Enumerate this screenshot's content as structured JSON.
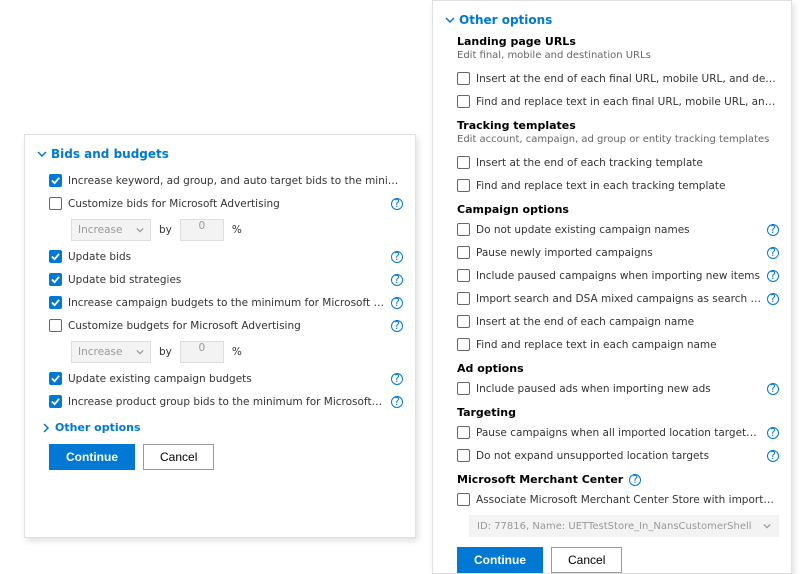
{
  "left": {
    "section_title": "Bids and budgets",
    "items": [
      {
        "checked": true,
        "label": "Increase keyword, ad group, and auto target bids to the minimum for Microsoft Adve",
        "help": false
      },
      {
        "checked": false,
        "label": "Customize bids for Microsoft Advertising",
        "help": true
      }
    ],
    "customize1": {
      "select": "Increase",
      "by_label": "by",
      "value": "0",
      "unit": "%"
    },
    "items2": [
      {
        "checked": true,
        "label": "Update bids",
        "help": true
      },
      {
        "checked": true,
        "label": "Update bid strategies",
        "help": true
      },
      {
        "checked": true,
        "label": "Increase campaign budgets to the minimum for Microsoft Advertising",
        "help": true
      },
      {
        "checked": false,
        "label": "Customize budgets for Microsoft Advertising",
        "help": true
      }
    ],
    "customize2": {
      "select": "Increase",
      "by_label": "by",
      "value": "0",
      "unit": "%"
    },
    "items3": [
      {
        "checked": true,
        "label": "Update existing campaign budgets",
        "help": true
      },
      {
        "checked": true,
        "label": "Increase product group bids to the minimum for Microsoft Advertising",
        "help": true
      }
    ],
    "other_options": "Other options",
    "continue": "Continue",
    "cancel": "Cancel"
  },
  "right": {
    "section_title": "Other options",
    "landing_header": "Landing page URLs",
    "landing_caption": "Edit final, mobile and destination URLs",
    "landing_items": [
      "Insert at the end of each final URL, mobile URL, and destination URL",
      "Find and replace text in each final URL, mobile URL, and destination URL"
    ],
    "tracking_header": "Tracking templates",
    "tracking_caption": "Edit account, campaign, ad group or entity tracking templates",
    "tracking_items": [
      "Insert at the end of each tracking template",
      "Find and replace text in each tracking template"
    ],
    "campaign_header": "Campaign options",
    "campaign_items": [
      {
        "label": "Do not update existing campaign names",
        "help": true
      },
      {
        "label": "Pause newly imported campaigns",
        "help": true
      },
      {
        "label": "Include paused campaigns when importing new items",
        "help": true
      },
      {
        "label": "Import search and DSA mixed campaigns as search campaigns",
        "help": true
      },
      {
        "label": "Insert at the end of each campaign name",
        "help": false
      },
      {
        "label": "Find and replace text in each campaign name",
        "help": false
      }
    ],
    "ad_header": "Ad options",
    "ad_items": [
      {
        "label": "Include paused ads when importing new ads",
        "help": true
      }
    ],
    "targeting_header": "Targeting",
    "targeting_items": [
      {
        "label": "Pause campaigns when all imported location targets are unsupported",
        "help": true
      },
      {
        "label": "Do not expand unsupported location targets",
        "help": true
      }
    ],
    "mmc_header": "Microsoft Merchant Center",
    "mmc_items": [
      {
        "label": "Associate Microsoft Merchant Center Store with imported shopping campaigns and ad e",
        "help": false
      }
    ],
    "store_row": "ID: 77816, Name: UETTestStore_In_NansCustomerShell",
    "continue": "Continue",
    "cancel": "Cancel"
  }
}
